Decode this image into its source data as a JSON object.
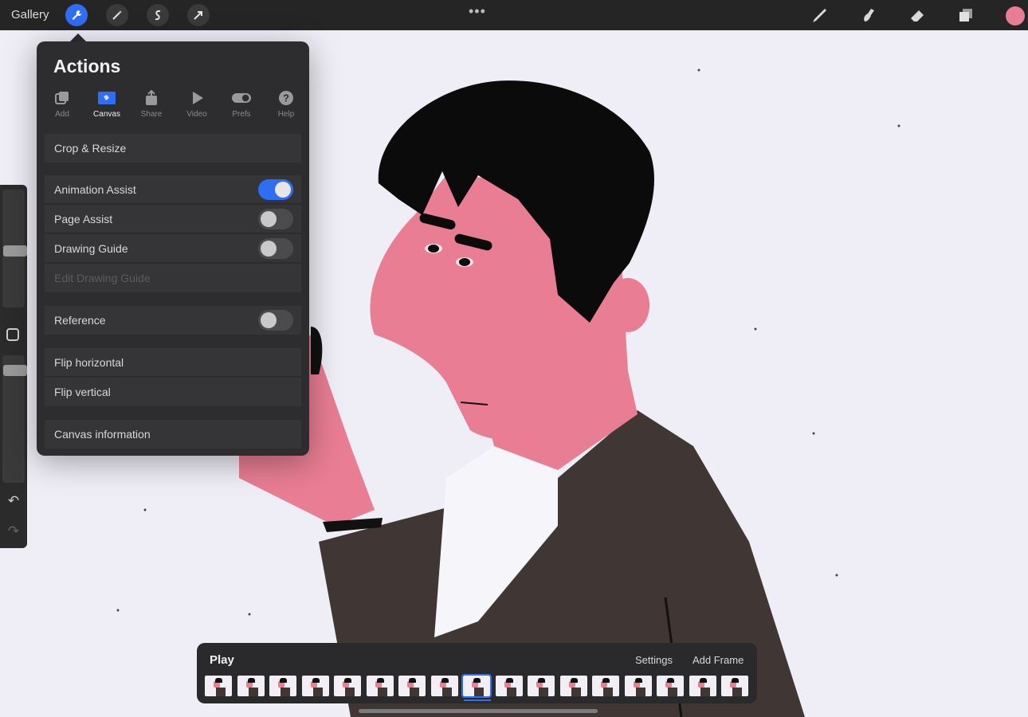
{
  "topbar": {
    "gallery_label": "Gallery",
    "tools": [
      {
        "icon": "wrench-icon",
        "active": true
      },
      {
        "icon": "magic-wand-icon",
        "active": false
      },
      {
        "icon": "selection-s-icon",
        "active": false
      },
      {
        "icon": "transform-arrow-icon",
        "active": false
      }
    ],
    "more_label": "•••",
    "right_tools": [
      "brush-icon",
      "smudge-icon",
      "eraser-icon",
      "layers-icon"
    ],
    "current_color": "#e87d93"
  },
  "actions": {
    "title": "Actions",
    "tabs": [
      {
        "label": "Add",
        "icon": "add-copy-icon",
        "active": false
      },
      {
        "label": "Canvas",
        "icon": "canvas-icon",
        "active": true
      },
      {
        "label": "Share",
        "icon": "share-icon",
        "active": false
      },
      {
        "label": "Video",
        "icon": "play-icon",
        "active": false
      },
      {
        "label": "Prefs",
        "icon": "toggle-icon",
        "active": false
      },
      {
        "label": "Help",
        "icon": "help-icon",
        "active": false
      }
    ],
    "items": {
      "crop_resize": "Crop & Resize",
      "animation_assist": "Animation Assist",
      "page_assist": "Page Assist",
      "drawing_guide": "Drawing Guide",
      "edit_drawing_guide": "Edit Drawing Guide",
      "reference": "Reference",
      "flip_horizontal": "Flip horizontal",
      "flip_vertical": "Flip vertical",
      "canvas_information": "Canvas information"
    },
    "toggles": {
      "animation_assist": true,
      "page_assist": false,
      "drawing_guide": false,
      "reference": false
    }
  },
  "timeline": {
    "play_label": "Play",
    "settings_label": "Settings",
    "add_frame_label": "Add Frame",
    "frame_count": 17,
    "current_frame": 9
  },
  "colors": {
    "accent": "#2f6df5",
    "skin": "#e87d93",
    "hair": "#0b0b0b",
    "jacket": "#403634",
    "canvas": "#efeef6"
  }
}
